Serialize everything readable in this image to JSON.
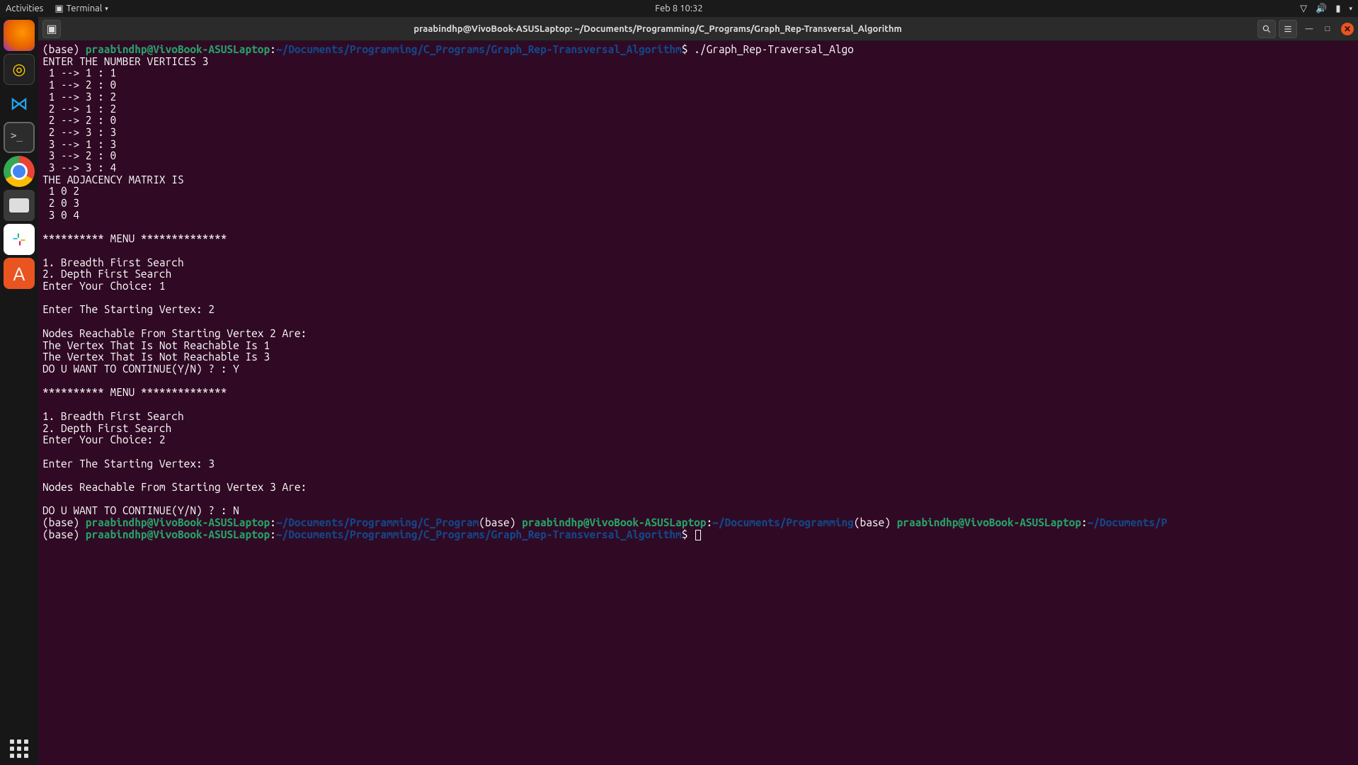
{
  "topbar": {
    "activities": "Activities",
    "app_icon": "▣",
    "app_name": "Terminal",
    "datetime": "Feb 8  10:32"
  },
  "titlebar": {
    "title": "praabindhp@VivoBook-ASUSLaptop: ~/Documents/Programming/C_Programs/Graph_Rep-Transversal_Algorithm"
  },
  "prompt": {
    "env": "(base) ",
    "userhost": "praabindhp@VivoBook-ASUSLaptop",
    "colon": ":",
    "path_full": "~/Documents/Programming/C_Programs/Graph_Rep-Transversal_Algorithm",
    "path_short": "~/Documents/Programming/C_Program",
    "path_mid": "~/Documents/Programming",
    "path_trunc": "~/Documents/P",
    "dollar": "$ ",
    "cmd": "./Graph_Rep-Traversal_Algo"
  },
  "output": {
    "l01": "ENTER THE NUMBER VERTICES 3",
    "l02": " 1 --> 1 : 1",
    "l03": " 1 --> 2 : 0",
    "l04": " 1 --> 3 : 2",
    "l05": " 2 --> 1 : 2",
    "l06": " 2 --> 2 : 0",
    "l07": " 2 --> 3 : 3",
    "l08": " 3 --> 1 : 3",
    "l09": " 3 --> 2 : 0",
    "l10": " 3 --> 3 : 4",
    "l11": "THE ADJACENCY MATRIX IS",
    "l12": " 1 0 2",
    "l13": " 2 0 3",
    "l14": " 3 0 4",
    "l15": "",
    "l16": "********** MENU **************",
    "l17": "",
    "l18": "1. Breadth First Search",
    "l19": "2. Depth First Search",
    "l20": "Enter Your Choice: 1",
    "l21": "",
    "l22": "Enter The Starting Vertex: 2",
    "l23": "",
    "l24": "Nodes Reachable From Starting Vertex 2 Are:",
    "l25": "The Vertex That Is Not Reachable Is 1",
    "l26": "The Vertex That Is Not Reachable Is 3",
    "l27": "DO U WANT TO CONTINUE(Y/N) ? : Y",
    "l28": "",
    "l29": "********** MENU **************",
    "l30": "",
    "l31": "1. Breadth First Search",
    "l32": "2. Depth First Search",
    "l33": "Enter Your Choice: 2",
    "l34": "",
    "l35": "Enter The Starting Vertex: 3",
    "l36": "",
    "l37": "Nodes Reachable From Starting Vertex 3 Are:",
    "l38": "",
    "l39": "DO U WANT TO CONTINUE(Y/N) ? : N"
  }
}
